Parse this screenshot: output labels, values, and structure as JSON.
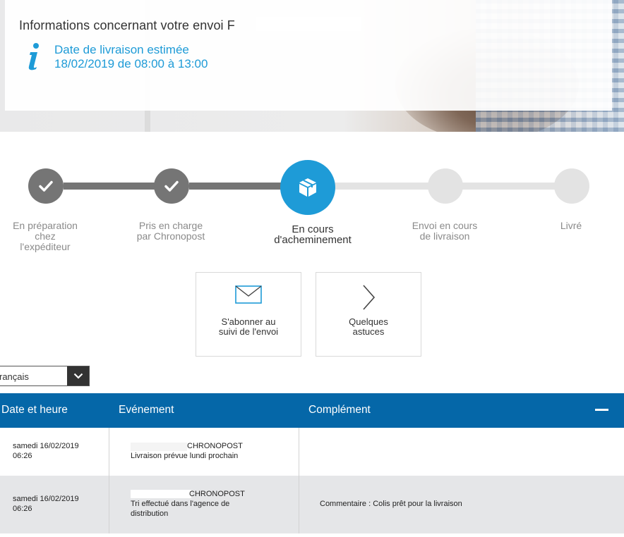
{
  "header": {
    "title": "Informations concernant votre envoi F",
    "delivery_label": "Date de livraison estimée",
    "delivery_window": "18/02/2019 de 08:00 à 13:00"
  },
  "steps": [
    {
      "label_lines": [
        "En préparation",
        "chez",
        "l'expéditeur"
      ],
      "state": "done"
    },
    {
      "label_lines": [
        "Pris en charge",
        "par Chronopost"
      ],
      "state": "done"
    },
    {
      "label_lines": [
        "En cours",
        "d'acheminement"
      ],
      "state": "current"
    },
    {
      "label_lines": [
        "Envoi en cours",
        "de livraison"
      ],
      "state": "todo"
    },
    {
      "label_lines": [
        "Livré"
      ],
      "state": "todo"
    }
  ],
  "actions": {
    "subscribe": {
      "line1": "S'abonner au",
      "line2": "suivi de l'envoi",
      "icon": "envelope-icon"
    },
    "tips": {
      "line1": "Quelques",
      "line2": "astuces",
      "icon": "chevron-right-icon"
    }
  },
  "language": {
    "selected": "rançais"
  },
  "table": {
    "headers": {
      "date": "Date et heure",
      "event": "Evénement",
      "complement": "Complément"
    },
    "rows": [
      {
        "date_line1": "samedi 16/02/2019",
        "date_line2": "06:26",
        "event_line1": "CHRONOPOST",
        "event_line2": "Livraison prévue lundi prochain",
        "event_line3": "",
        "complement": ""
      },
      {
        "date_line1": "samedi 16/02/2019",
        "date_line2": "06:26",
        "event_line1": "CHRONOPOST",
        "event_line2": "Tri effectué dans l'agence de",
        "event_line3": "distribution",
        "complement": "Commentaire : Colis prêt pour la livraison"
      }
    ]
  },
  "colors": {
    "primary": "#1e9bd7",
    "header_blue": "#0567a8",
    "done_gray": "#757575",
    "todo_gray": "#e3e3e3"
  }
}
